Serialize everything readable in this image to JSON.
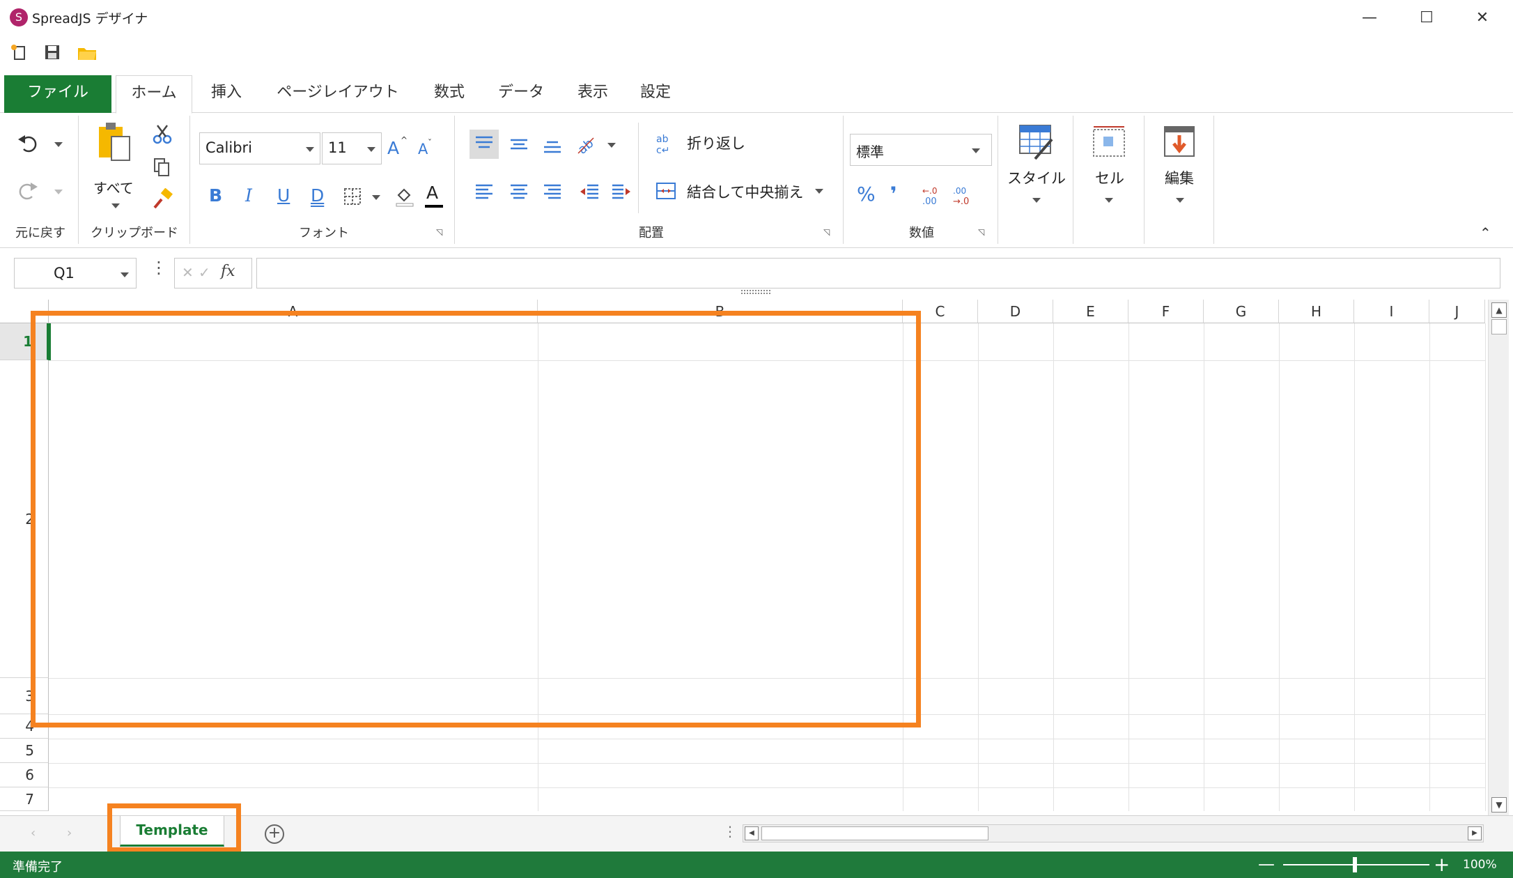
{
  "window": {
    "title": "SpreadJS デザイナ",
    "minimize": "—",
    "maximize": "☐",
    "close": "✕"
  },
  "tabs": [
    {
      "label": "ファイル"
    },
    {
      "label": "ホーム"
    },
    {
      "label": "挿入"
    },
    {
      "label": "ページレイアウト"
    },
    {
      "label": "数式"
    },
    {
      "label": "データ"
    },
    {
      "label": "表示"
    },
    {
      "label": "設定"
    }
  ],
  "ribbon": {
    "undo_group": "元に戻す",
    "clipboard": {
      "label": "クリップボード",
      "paste_all": "すべて"
    },
    "font": {
      "label": "フォント",
      "name": "Calibri",
      "size": "11",
      "bold": "B",
      "italic": "I",
      "underline": "U",
      "double_underline": "D",
      "grow": "A",
      "shrink": "A",
      "font_color": "A"
    },
    "alignment": {
      "label": "配置",
      "wrap": "折り返し",
      "merge": "結合して中央揃え"
    },
    "number": {
      "label": "数値",
      "format": "標準",
      "percent": "%",
      "comma": "❜"
    },
    "style": "スタイル",
    "cell": "セル",
    "edit": "編集"
  },
  "formula_bar": {
    "name_box": "Q1",
    "fx": "fx",
    "value": ""
  },
  "grid": {
    "columns": [
      "A",
      "B",
      "C",
      "D",
      "E",
      "F",
      "G",
      "H",
      "I",
      "J"
    ],
    "rows": [
      "1",
      "2",
      "3",
      "4",
      "5",
      "6",
      "7"
    ]
  },
  "sheets": [
    {
      "name": "Template"
    }
  ],
  "status": {
    "text": "準備完了",
    "zoom": "100%"
  },
  "colors": {
    "accent": "#1a7d34",
    "highlight": "#f58220"
  }
}
